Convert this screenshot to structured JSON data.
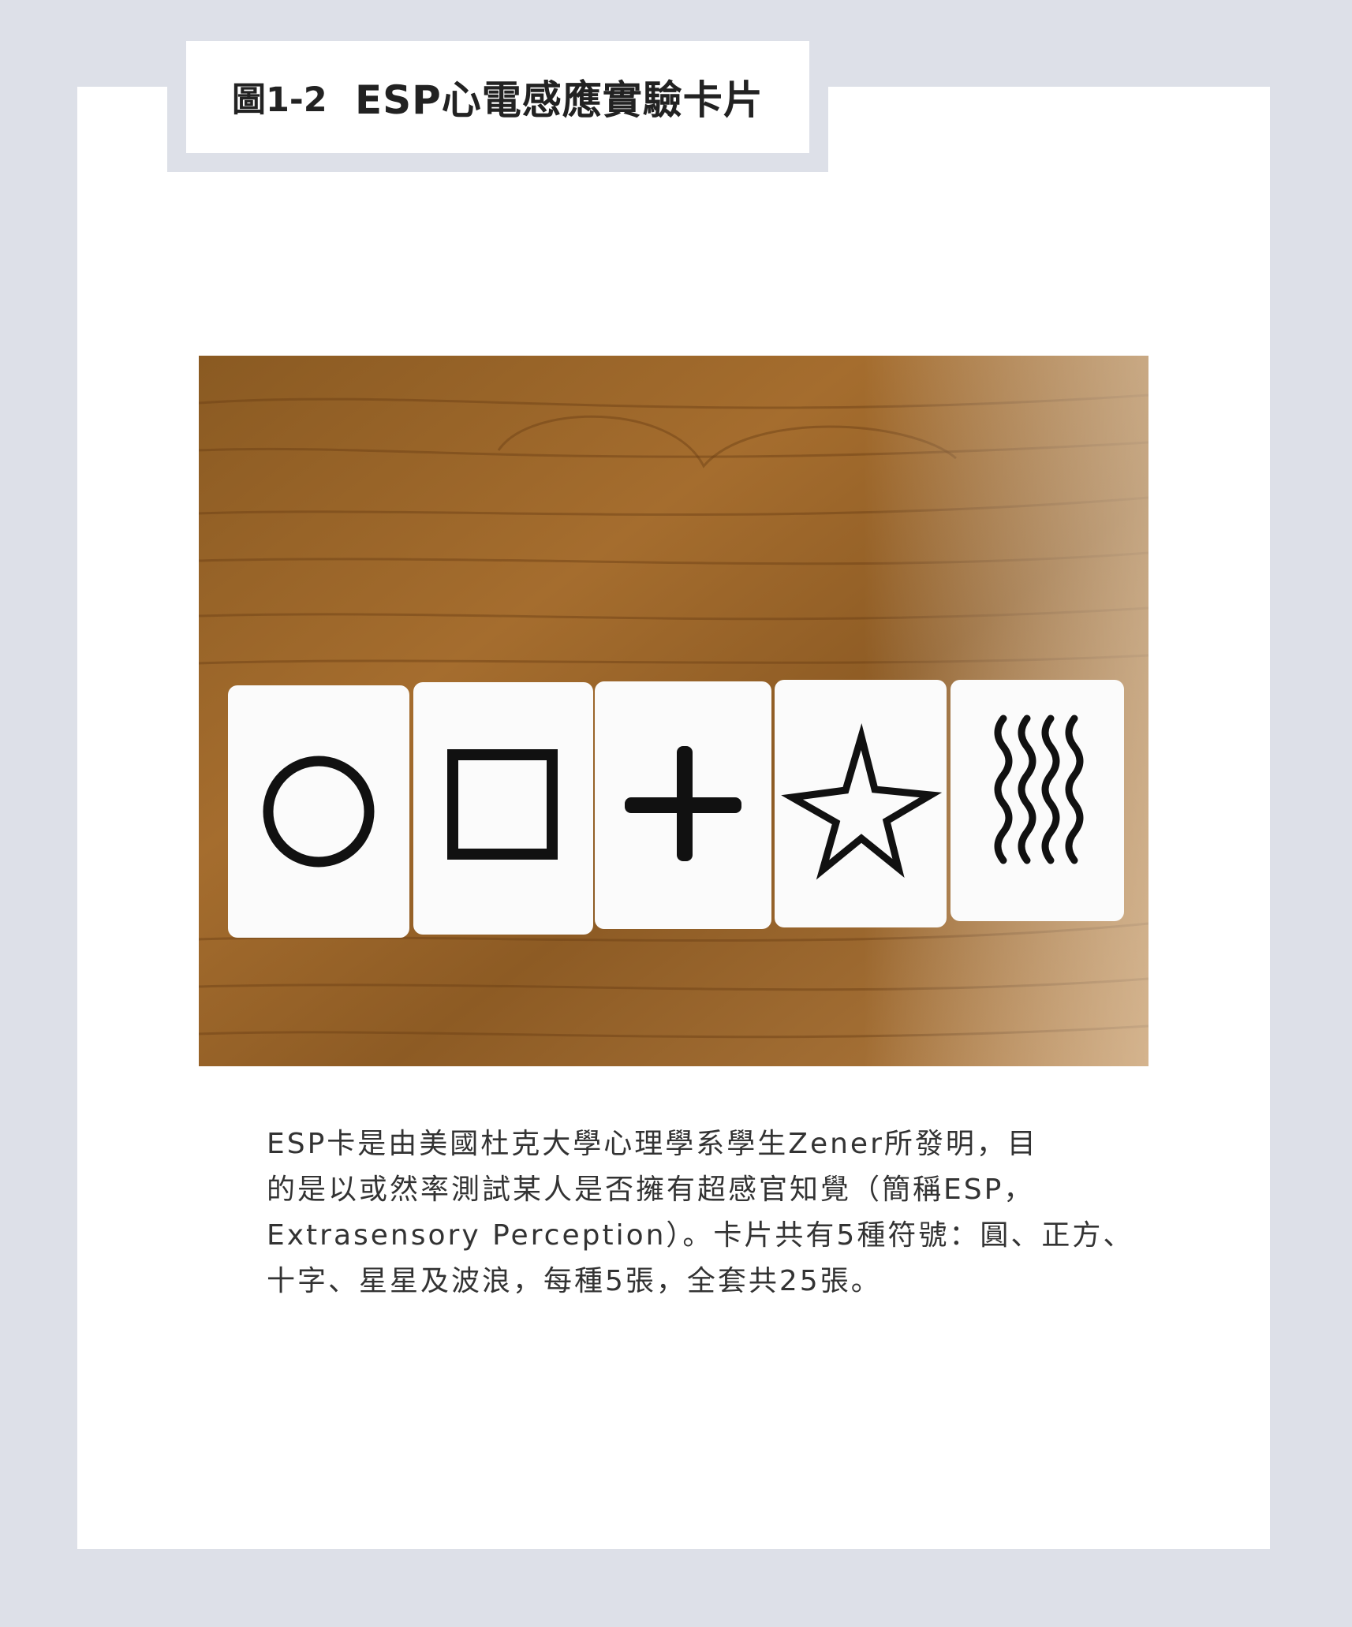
{
  "figure": {
    "number": "圖1-2",
    "title": "ESP心電感應實驗卡片"
  },
  "photo": {
    "cards": [
      {
        "symbol": "circle-icon"
      },
      {
        "symbol": "square-icon"
      },
      {
        "symbol": "cross-icon"
      },
      {
        "symbol": "star-icon"
      },
      {
        "symbol": "waves-icon"
      }
    ]
  },
  "caption": {
    "lines": [
      "ESP卡是由美國杜克大學心理學系學生Zener所發明，目",
      "的是以或然率測試某人是否擁有超感官知覺（簡稱ESP，",
      "Extrasensory Perception）。卡片共有5種符號：圓、正方、",
      "十字、星星及波浪，每種5張，全套共25張。"
    ]
  }
}
